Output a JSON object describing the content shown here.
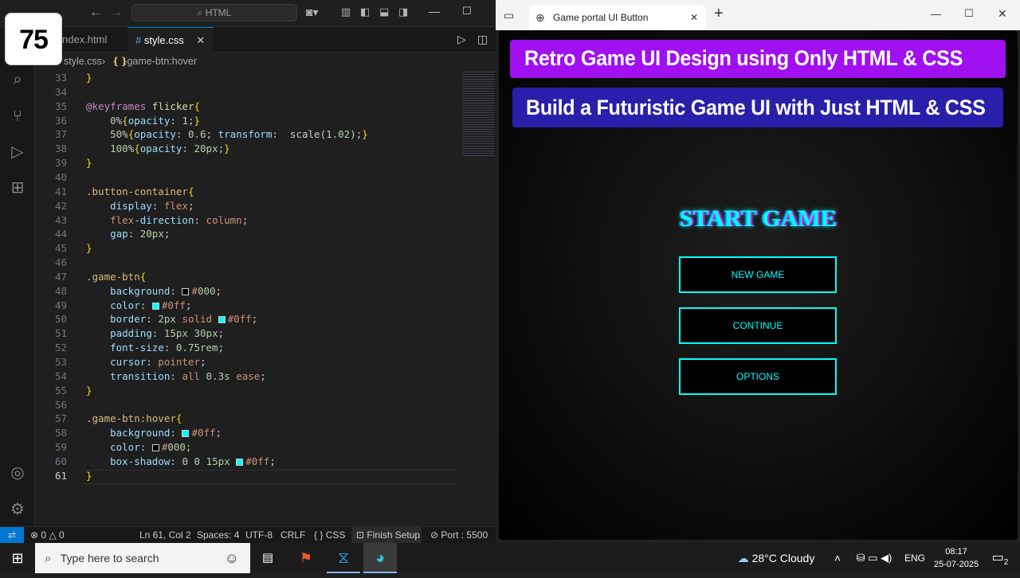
{
  "badge": "75",
  "vscode": {
    "search_placeholder": "HTML",
    "tabs": [
      {
        "label": "ndex.html",
        "icon": "html-file-icon"
      },
      {
        "label": "style.css",
        "icon": "css-file-icon",
        "active": true
      }
    ],
    "tab_close": "✕",
    "breadcrumb": {
      "file": "style.css",
      "symbol": ".game-btn:hover"
    },
    "current_line": 61,
    "status": {
      "errors": "0",
      "warnings": "0",
      "position": "Ln 61, Col 2",
      "spaces": "Spaces: 4",
      "encoding": "UTF-8",
      "eol": "CRLF",
      "language": "CSS",
      "finish_setup": "Finish Setup",
      "port": "Port : 5500"
    }
  },
  "code_lines": [
    {
      "n": "33",
      "text": "}"
    },
    {
      "n": "34",
      "text": ""
    },
    {
      "n": "35",
      "text": "@keyframes flicker{"
    },
    {
      "n": "36",
      "text": "    0%{opacity: 1;}"
    },
    {
      "n": "37",
      "text": "    50%{opacity: 0.6; transform:  scale(1.02);}"
    },
    {
      "n": "38",
      "text": "    100%{opacity: 20px;}"
    },
    {
      "n": "39",
      "text": "}"
    },
    {
      "n": "40",
      "text": ""
    },
    {
      "n": "41",
      "text": ".button-container{"
    },
    {
      "n": "42",
      "text": "    display: flex;"
    },
    {
      "n": "43",
      "text": "    flex-direction: column;"
    },
    {
      "n": "44",
      "text": "    gap: 20px;"
    },
    {
      "n": "45",
      "text": "}"
    },
    {
      "n": "46",
      "text": ""
    },
    {
      "n": "47",
      "text": ".game-btn{"
    },
    {
      "n": "48",
      "text": "    background: #000;"
    },
    {
      "n": "49",
      "text": "    color: #0ff;"
    },
    {
      "n": "50",
      "text": "    border: 2px solid #0ff;"
    },
    {
      "n": "51",
      "text": "    padding: 15px 30px;"
    },
    {
      "n": "52",
      "text": "    font-size: 0.75rem;"
    },
    {
      "n": "53",
      "text": "    cursor: pointer;"
    },
    {
      "n": "54",
      "text": "    transition: all 0.3s ease;"
    },
    {
      "n": "55",
      "text": "}"
    },
    {
      "n": "56",
      "text": ""
    },
    {
      "n": "57",
      "text": ".game-btn:hover{"
    },
    {
      "n": "58",
      "text": "    background: #0ff;"
    },
    {
      "n": "59",
      "text": "    color: #000;"
    },
    {
      "n": "60",
      "text": "    box-shadow: 0 0 15px #0ff;"
    },
    {
      "n": "61",
      "text": "}"
    }
  ],
  "browser": {
    "tab_title": "Game portal UI Button",
    "tab_close": "✕",
    "new_tab": "+",
    "banner1": "Retro Game UI Design using Only HTML & CSS",
    "banner2": "Build a Futuristic Game UI with Just HTML & CSS",
    "game_title": "START GAME",
    "buttons": [
      "NEW GAME",
      "CONTINUE",
      "OPTIONS"
    ],
    "colors": {
      "banner1": "#a010f0",
      "banner2": "#2a1faa",
      "neon": "#00ffff"
    }
  },
  "taskbar": {
    "search_placeholder": "Type here to search",
    "weather": "28°C  Cloudy",
    "language": "ENG",
    "time": "08:17",
    "date": "25-07-2025",
    "notifications": "2"
  }
}
